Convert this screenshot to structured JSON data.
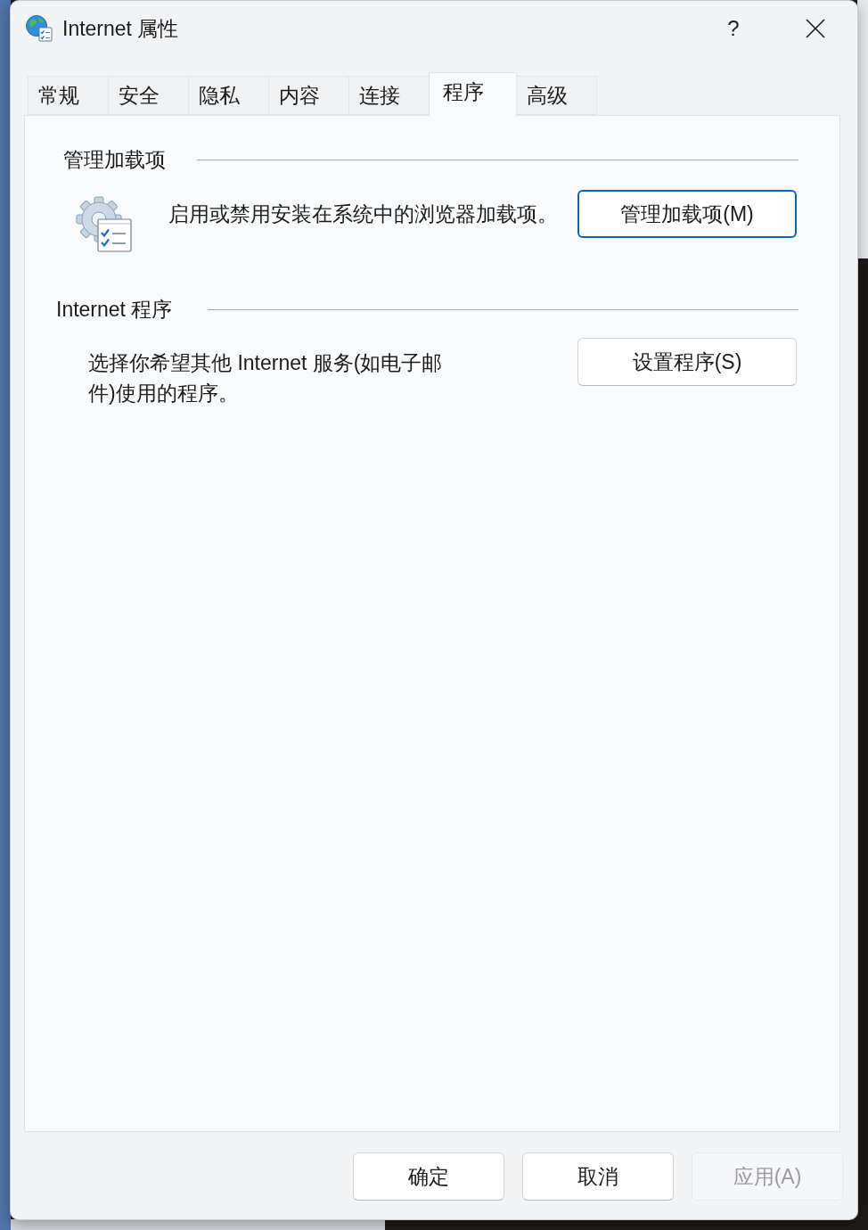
{
  "window": {
    "title": "Internet 属性",
    "help": "?"
  },
  "tabs": [
    {
      "label": "常规",
      "selected": false
    },
    {
      "label": "安全",
      "selected": false
    },
    {
      "label": "隐私",
      "selected": false
    },
    {
      "label": "内容",
      "selected": false
    },
    {
      "label": "连接",
      "selected": false
    },
    {
      "label": "程序",
      "selected": true
    },
    {
      "label": "高级",
      "selected": false
    }
  ],
  "groups": [
    {
      "kind": "icon",
      "heading": "管理加载项",
      "description_lines": [
        "启用或禁用安装在系统中的浏览器加载项。"
      ],
      "button": {
        "label": "管理加载项(M)",
        "focused": true
      }
    },
    {
      "kind": "plain",
      "heading": "Internet 程序",
      "description_lines": [
        "选择你希望其他 Internet 服务(如电子邮",
        "件)使用的程序。"
      ],
      "button": {
        "label": "设置程序(S)",
        "focused": false
      }
    }
  ],
  "buttons": [
    {
      "label": "确定",
      "disabled": false
    },
    {
      "label": "取消",
      "disabled": false
    },
    {
      "label": "应用(A)",
      "disabled": true
    }
  ]
}
